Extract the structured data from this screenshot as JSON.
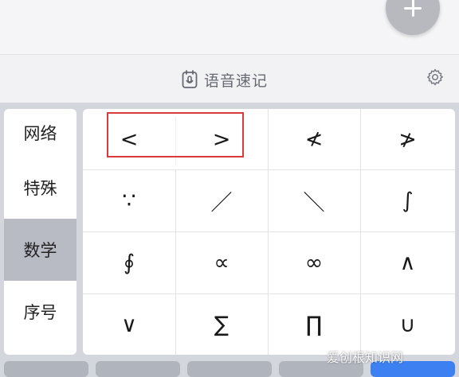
{
  "toolbar": {
    "voice_note_label": "语音速记"
  },
  "sidebar": {
    "items": [
      {
        "label": "网络",
        "active": false
      },
      {
        "label": "特殊",
        "active": false
      },
      {
        "label": "数学",
        "active": true
      },
      {
        "label": "序号",
        "active": false
      }
    ]
  },
  "symbols": {
    "rows": [
      [
        "<",
        ">",
        "≮",
        "≯"
      ],
      [
        "∵",
        "／",
        "＼",
        "∫"
      ],
      [
        "∮",
        "∝",
        "∞",
        "∧"
      ],
      [
        "∨",
        "∑",
        "∏",
        "∪"
      ]
    ]
  },
  "watermark": "爱创根知识网",
  "colors": {
    "highlight": "#d93a3a",
    "active_sidebar": "#b8bbc4",
    "accent_blue": "#3d80f2"
  }
}
